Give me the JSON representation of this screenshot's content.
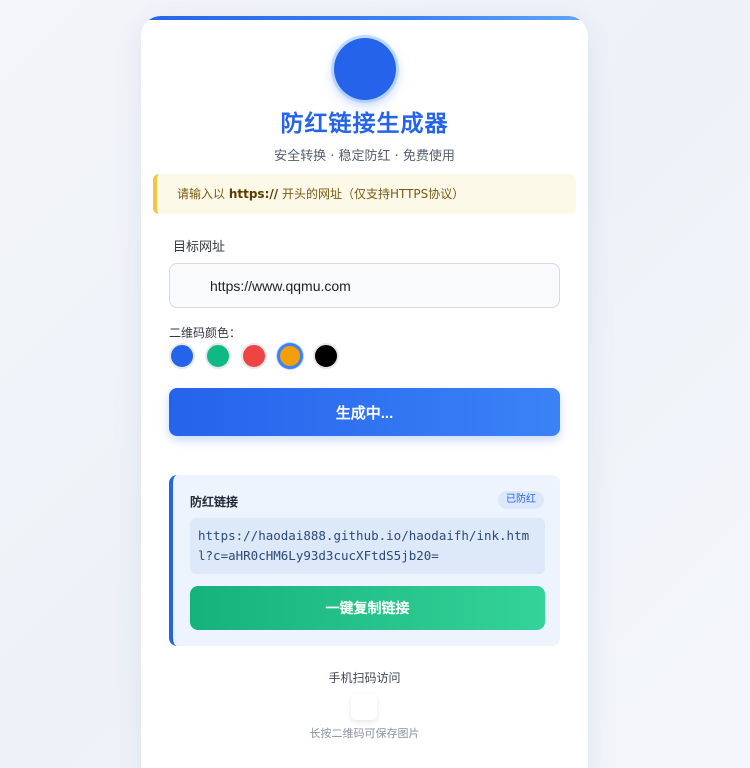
{
  "header": {
    "title": "防红链接生成器",
    "subtitle": "安全转换 · 稳定防红 · 免费使用"
  },
  "notice": {
    "prefix": "请输入以 ",
    "highlight": "https://",
    "suffix": " 开头的网址（仅支持HTTPS协议）"
  },
  "form": {
    "url_label": "目标网址",
    "url_value": "https://www.qqmu.com",
    "color_label": "二维码颜色：",
    "colors": [
      "#2563eb",
      "#10b981",
      "#ef4444",
      "#f59e0b",
      "#000000"
    ],
    "selected_color": "#f59e0b",
    "generate_label": "生成中..."
  },
  "result": {
    "title": "防红链接",
    "badge": "已防红",
    "link": "https://haodai888.github.io/haodaifh/ink.html?c=aHR0cHM6Ly93d3cucXFtdS5jb20=",
    "copy_label": "一键复制链接"
  },
  "qr": {
    "title": "手机扫码访问",
    "hint": "长按二维码可保存图片"
  }
}
